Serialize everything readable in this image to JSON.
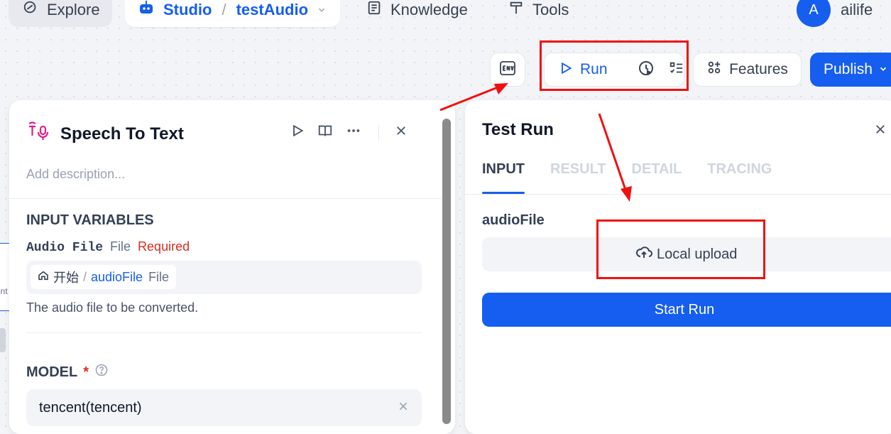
{
  "nav": {
    "explore": "Explore",
    "studio": "Studio",
    "separator": "/",
    "app_name": "testAudio",
    "knowledge": "Knowledge",
    "tools": "Tools"
  },
  "user": {
    "avatar_initial": "A",
    "name": "ailife"
  },
  "toolbar": {
    "run_label": "Run",
    "features_label": "Features",
    "publish_label": "Publish"
  },
  "node_panel": {
    "title": "Speech To Text",
    "description_placeholder": "Add description...",
    "input_variables_title": "INPUT VARIABLES",
    "variable": {
      "name": "Audio File",
      "type": "File",
      "required": "Required",
      "source_node": "开始",
      "slash": "/",
      "reference": "audioFile",
      "reference_type": "File",
      "help": "The audio file to be converted."
    },
    "model_title": "MODEL",
    "model_required_mark": "*",
    "model_value": "tencent(tencent)"
  },
  "test_run": {
    "title": "Test Run",
    "tabs": [
      {
        "label": "INPUT",
        "active": true
      },
      {
        "label": "RESULT",
        "active": false
      },
      {
        "label": "DETAIL",
        "active": false
      },
      {
        "label": "TRACING",
        "active": false
      }
    ],
    "field_label": "audioFile",
    "upload_label": "Local upload",
    "start_run_label": "Start Run"
  },
  "canvas_fragment": "ent",
  "colors": {
    "primary": "#155eef",
    "required": "#d92d20",
    "annotation": "#f01010",
    "node_icon": "#e11d8a"
  }
}
